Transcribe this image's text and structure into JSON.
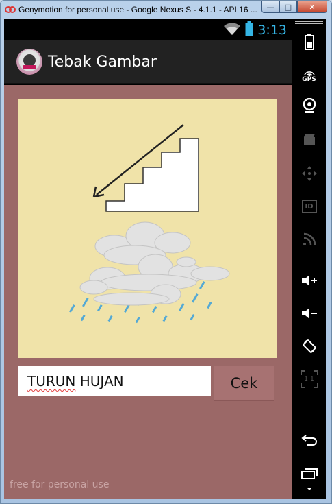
{
  "window": {
    "title": "Genymotion for personal use - Google Nexus S - 4.1.1 - API 16 ...",
    "min_glyph": "—",
    "max_glyph": "□",
    "close_glyph": "✕"
  },
  "status_bar": {
    "time": "3:13"
  },
  "app": {
    "title": "Tebak Gambar",
    "answer_word1": "TURUN",
    "answer_word2": " HUJAN",
    "check_label": "Cek",
    "watermark": "free for personal use"
  },
  "toolbar": {
    "gps_label": "GPS",
    "id_label": "ID",
    "scale_label": "1:1"
  },
  "colors": {
    "content_bg": "#9b6867",
    "image_bg": "#f0e3a9",
    "button_bg": "#a77272",
    "time_color": "#35b5e5"
  }
}
